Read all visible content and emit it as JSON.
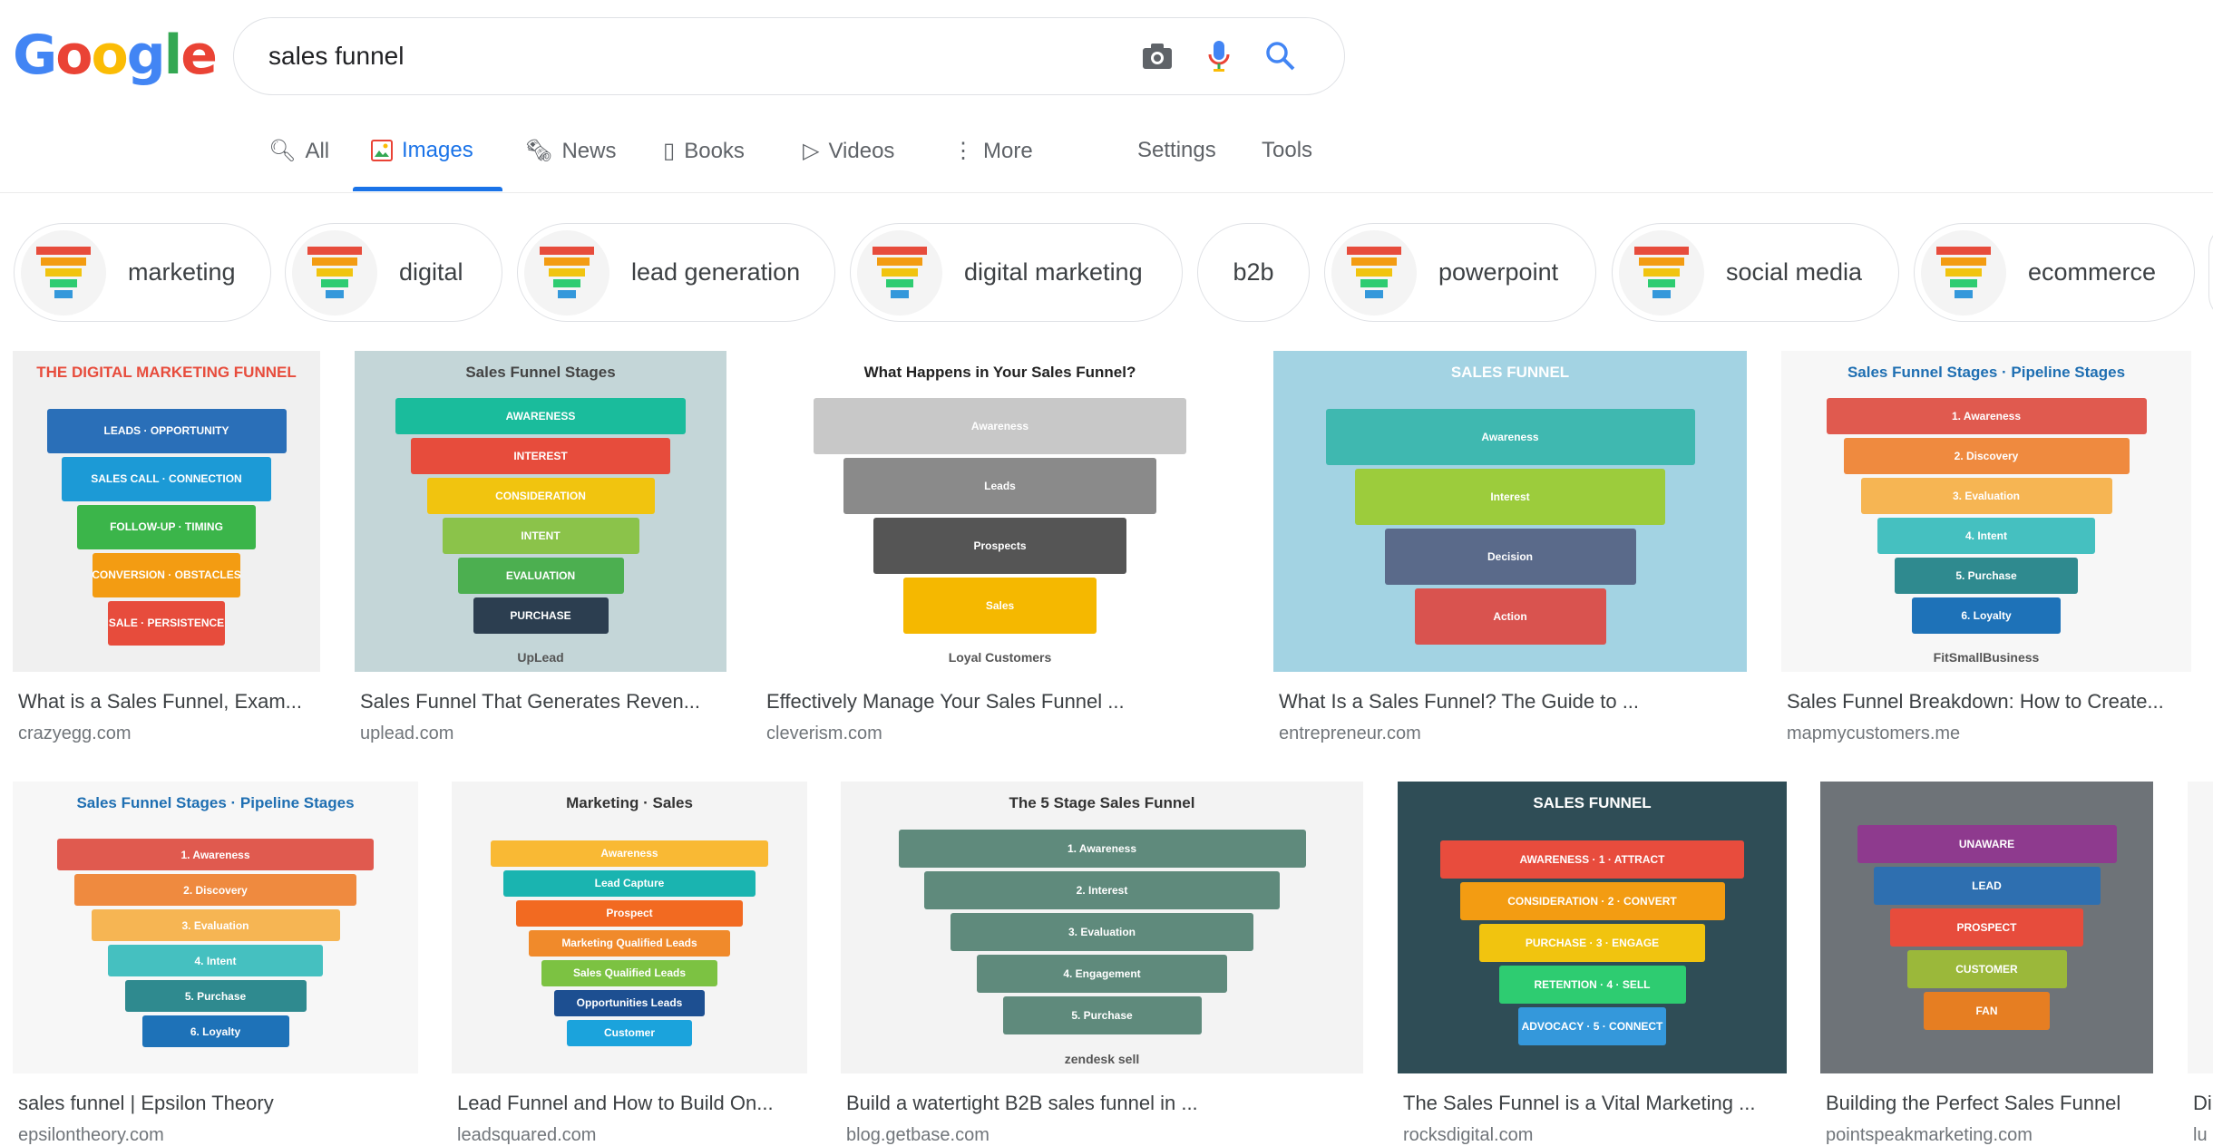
{
  "logo": {
    "text": "Google",
    "letters": [
      [
        "G",
        "#4285f4"
      ],
      [
        "o",
        "#ea4335"
      ],
      [
        "o",
        "#fbbc05"
      ],
      [
        "g",
        "#4285f4"
      ],
      [
        "l",
        "#34a853"
      ],
      [
        "e",
        "#ea4335"
      ]
    ]
  },
  "search": {
    "query": "sales funnel",
    "camera_icon": "camera-icon",
    "mic_icon": "mic-icon",
    "search_icon": "search-icon"
  },
  "tabs": [
    {
      "label": "All",
      "icon": "search-icon"
    },
    {
      "label": "Images",
      "icon": "image-icon",
      "active": true
    },
    {
      "label": "News",
      "icon": "news-icon"
    },
    {
      "label": "Books",
      "icon": "book-icon"
    },
    {
      "label": "Videos",
      "icon": "video-icon"
    },
    {
      "label": "More",
      "icon": "more-icon"
    }
  ],
  "settings": "Settings",
  "tools": "Tools",
  "chips": [
    {
      "label": "marketing",
      "thumb": true
    },
    {
      "label": "digital",
      "thumb": true
    },
    {
      "label": "lead generation",
      "thumb": true
    },
    {
      "label": "digital marketing",
      "thumb": true
    },
    {
      "label": "b2b",
      "thumb": false
    },
    {
      "label": "powerpoint",
      "thumb": true
    },
    {
      "label": "social media",
      "thumb": true
    },
    {
      "label": "ecommerce",
      "thumb": true
    }
  ],
  "results": [
    {
      "title": "What is a Sales Funnel, Exam...",
      "source": "crazyegg.com",
      "image": {
        "bg": "#f0f0f0",
        "heading": "THE DIGITAL MARKETING FUNNEL",
        "hcolor": "#e74c3c",
        "stages": [
          [
            "LEADS · OPPORTUNITY",
            "#2a6fb8"
          ],
          [
            "SALES CALL · CONNECTION",
            "#1c9ad6"
          ],
          [
            "FOLLOW-UP · TIMING",
            "#3bb54a"
          ],
          [
            "CONVERSION · OBSTACLES",
            "#f39c12"
          ],
          [
            "SALE · PERSISTENCE",
            "#e74c3c"
          ]
        ]
      }
    },
    {
      "title": "Sales Funnel That Generates Reven...",
      "source": "uplead.com",
      "image": {
        "bg": "#c4d6d8",
        "heading": "Sales Funnel Stages",
        "hcolor": "#444",
        "stages": [
          [
            "AWARENESS",
            "#1abc9c"
          ],
          [
            "INTEREST",
            "#e74c3c"
          ],
          [
            "CONSIDERATION",
            "#f1c40f"
          ],
          [
            "INTENT",
            "#8bc34a"
          ],
          [
            "EVALUATION",
            "#4caf50"
          ],
          [
            "PURCHASE",
            "#2c3e50"
          ]
        ],
        "footer": "UpLead"
      }
    },
    {
      "title": "Effectively Manage Your Sales Funnel ...",
      "source": "cleverism.com",
      "image": {
        "bg": "#ffffff",
        "heading": "What Happens in Your Sales Funnel?",
        "hcolor": "#222",
        "stages": [
          [
            "Awareness",
            "#c8c8c8"
          ],
          [
            "Leads",
            "#8a8a8a"
          ],
          [
            "Prospects",
            "#555"
          ],
          [
            "Sales",
            "#f5b800"
          ]
        ],
        "footer": "Loyal Customers"
      }
    },
    {
      "title": "What Is a Sales Funnel? The Guide to ...",
      "source": "entrepreneur.com",
      "image": {
        "bg": "#a3d3e3",
        "heading": "SALES FUNNEL",
        "hcolor": "#fff",
        "stages": [
          [
            "Awareness",
            "#3fb8b0"
          ],
          [
            "Interest",
            "#9ccc3c"
          ],
          [
            "Decision",
            "#5a6a8a"
          ],
          [
            "Action",
            "#d9534f"
          ]
        ]
      }
    },
    {
      "title": "Sales Funnel Breakdown: How to Create...",
      "source": "mapmycustomers.me",
      "image": {
        "bg": "#f7f7f7",
        "heading": "Sales Funnel Stages · Pipeline Stages",
        "hcolor": "#1f6fb2",
        "stages": [
          [
            "1. Awareness",
            "#e05a4f"
          ],
          [
            "2. Discovery",
            "#ef8a3f"
          ],
          [
            "3. Evaluation",
            "#f6b553"
          ],
          [
            "4. Intent",
            "#45c0c0"
          ],
          [
            "5. Purchase",
            "#2f8a8f"
          ],
          [
            "6. Loyalty",
            "#1e72b8"
          ]
        ],
        "footer": "FitSmallBusiness"
      }
    },
    {
      "title": "sales funnel | Epsilon Theory",
      "source": "epsilontheory.com",
      "image": {
        "bg": "#f7f7f7",
        "heading": "Sales Funnel Stages · Pipeline Stages",
        "hcolor": "#1f6fb2",
        "stages": [
          [
            "1. Awareness",
            "#e05a4f"
          ],
          [
            "2. Discovery",
            "#ef8a3f"
          ],
          [
            "3. Evaluation",
            "#f6b553"
          ],
          [
            "4. Intent",
            "#45c0c0"
          ],
          [
            "5. Purchase",
            "#2f8a8f"
          ],
          [
            "6. Loyalty",
            "#1e72b8"
          ]
        ]
      }
    },
    {
      "title": "Lead Funnel and How to Build On...",
      "source": "leadsquared.com",
      "image": {
        "bg": "#f4f4f4",
        "heading": "Marketing · Sales",
        "hcolor": "#333",
        "stages": [
          [
            "Awareness",
            "#f9b934"
          ],
          [
            "Lead Capture",
            "#1ab4b0"
          ],
          [
            "Prospect",
            "#f26a21"
          ],
          [
            "Marketing Qualified Leads",
            "#f08a2b"
          ],
          [
            "Sales Qualified Leads",
            "#7cc242"
          ],
          [
            "Opportunities Leads",
            "#1d4f91"
          ],
          [
            "Customer",
            "#1ba3dc"
          ]
        ]
      }
    },
    {
      "title": "Build a watertight B2B sales funnel in ...",
      "source": "blog.getbase.com",
      "image": {
        "bg": "#f3f3f3",
        "heading": "The 5 Stage Sales Funnel",
        "hcolor": "#333",
        "stages": [
          [
            "1. Awareness",
            "#5f8a7c"
          ],
          [
            "2. Interest",
            "#5f8a7c"
          ],
          [
            "3. Evaluation",
            "#5f8a7c"
          ],
          [
            "4. Engagement",
            "#5f8a7c"
          ],
          [
            "5. Purchase",
            "#5f8a7c"
          ]
        ],
        "footer": "zendesk sell"
      }
    },
    {
      "title": "The Sales Funnel is a Vital Marketing ...",
      "source": "rocksdigital.com",
      "image": {
        "bg": "#2f4d56",
        "heading": "SALES FUNNEL",
        "hcolor": "#fff",
        "stages": [
          [
            "AWARENESS · 1 · ATTRACT",
            "#e84c3d"
          ],
          [
            "CONSIDERATION · 2 · CONVERT",
            "#f39c12"
          ],
          [
            "PURCHASE · 3 · ENGAGE",
            "#f1c40f"
          ],
          [
            "RETENTION · 4 · SELL",
            "#2ecc71"
          ],
          [
            "ADVOCACY · 5 · CONNECT",
            "#3498db"
          ]
        ]
      }
    },
    {
      "title": "Building the Perfect Sales Funnel",
      "source": "pointspeakmarketing.com",
      "image": {
        "bg": "#6e7378",
        "heading": "",
        "hcolor": "#fff",
        "stages": [
          [
            "UNAWARE",
            "#8e3a8e"
          ],
          [
            "LEAD",
            "#2e6fb0"
          ],
          [
            "PROSPECT",
            "#e74c3c"
          ],
          [
            "CUSTOMER",
            "#9bb83a"
          ],
          [
            "FAN",
            "#e67e22"
          ]
        ]
      }
    },
    {
      "title": "Di",
      "source": "lu",
      "image": {
        "bg": "#f6f6f6",
        "heading": "",
        "hcolor": "#333",
        "stages": []
      }
    }
  ]
}
